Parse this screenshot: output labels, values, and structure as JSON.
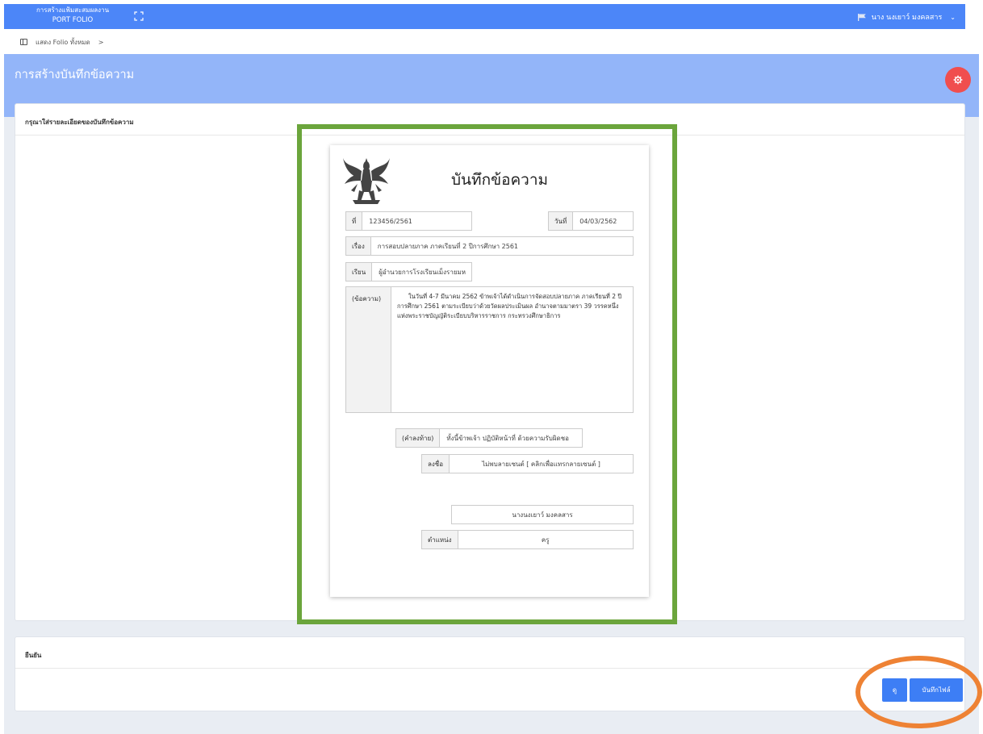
{
  "topbar": {
    "brand_line1": "การสร้างแฟ้มสะสมผลงาน",
    "brand_line2": "PORT FOLIO",
    "user_name": "นาง นงเยาว์ มงคลสาร"
  },
  "breadcrumb": {
    "label": "แสดง Folio ทั้งหมด",
    "separator": ">"
  },
  "page": {
    "title": "การสร้างบันทึกข้อความ"
  },
  "details_card": {
    "header": "กรุณาใส่รายละเอียดของบันทึกข้อความ"
  },
  "memo": {
    "title": "บันทึกข้อความ",
    "number_label": "ที่",
    "number_value": "123456/2561",
    "date_label": "วันที่",
    "date_value": "04/03/2562",
    "subject_label": "เรื่อง",
    "subject_value": "การสอบปลายภาค ภาคเรียนที่ 2 ปีการศึกษา 2561",
    "to_label": "เรียน",
    "to_value": "ผู้อำนวยการโรงเรียนเม็งรายมห",
    "message_label": "(ข้อความ)",
    "message_value": "ในวันที่ 4-7 มีนาคม 2562 ข้าพเจ้าได้ดำเนินการจัดสอบปลายภาค ภาคเรียนที่ 2 ปีการศึกษา 2561 ตามระเบียบว่าด้วยวัดผลประเมินผล อำนาจตามมาตรา 39 วรรคหนึ่ง แห่งพระราชบัญญัติระเบียบบริหารราชการ กระทรวงศึกษาธิการ",
    "closing_label": "(คำลงท้าย)",
    "closing_value": "ทั้งนี้ข้าพเจ้า ปฏิบัติหน้าที่ ด้วยความรับผิดชอ",
    "signature_label": "ลงชื่อ",
    "signature_value": "ไม่พบลายเซนต์ [ คลิกเพื่อแทรกลายเซนต์ ]",
    "signer_name": "นางนงเยาว์ มงคลสาร",
    "position_label": "ตำแหน่ง",
    "position_value": "ครู"
  },
  "confirm_card": {
    "header": "ยืนยัน",
    "view_button": "ดู",
    "save_button": "บันทึกไฟล์"
  },
  "colors": {
    "topbar": "#4c86f8",
    "banner": "#93b5f9",
    "settings_button": "#f04e4e",
    "highlight_frame": "#6ba53c",
    "highlight_ring": "#ee8234",
    "primary_button": "#3d7ef5"
  },
  "icons": {
    "expand": "expand-icon",
    "user_flag": "flag-icon",
    "dropdown": "chevron-down-icon",
    "breadcrumb": "sidebar-toggle-icon",
    "settings": "gear-icon",
    "emblem": "garuda-emblem"
  }
}
